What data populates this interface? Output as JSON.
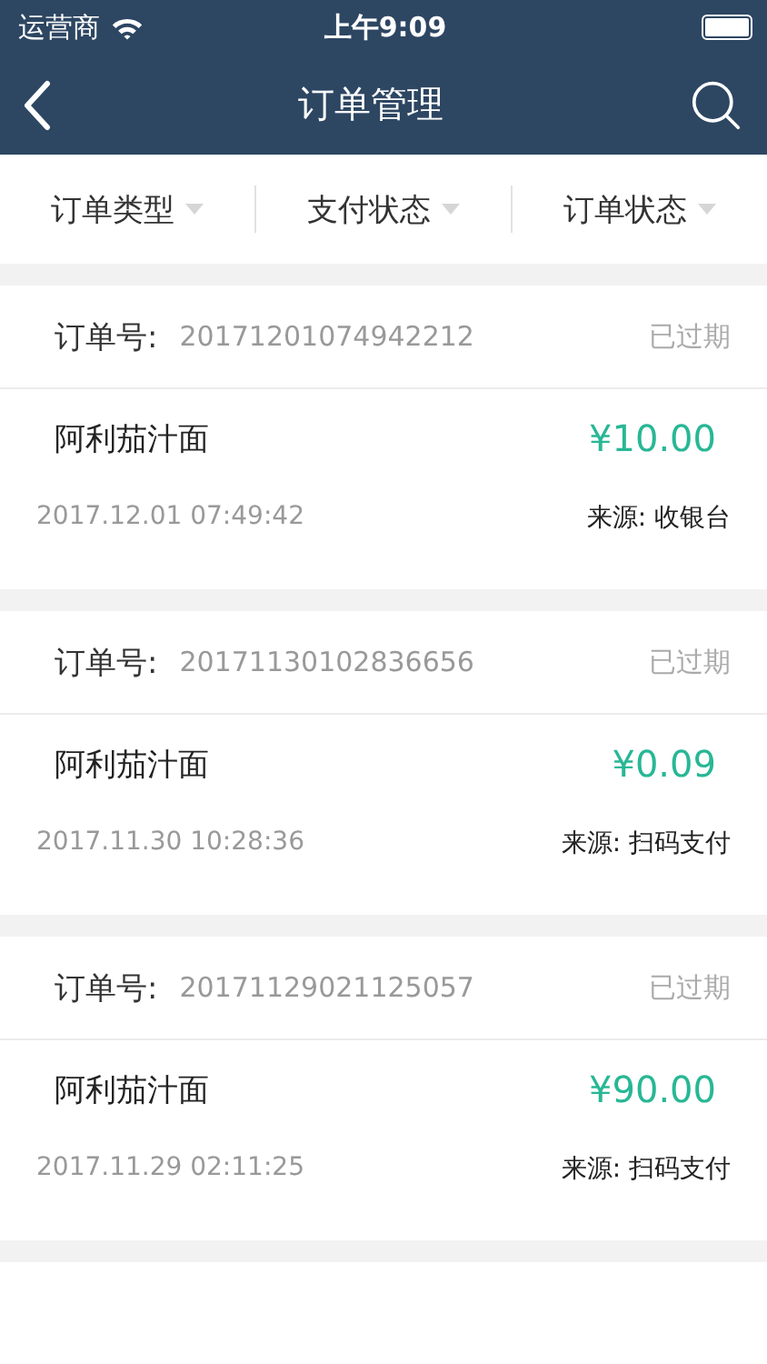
{
  "status_bar": {
    "carrier": "运营商",
    "time": "上午9:09"
  },
  "nav": {
    "title": "订单管理"
  },
  "filters": [
    {
      "label": "订单类型"
    },
    {
      "label": "支付状态"
    },
    {
      "label": "订单状态"
    }
  ],
  "orders": [
    {
      "number_label": "订单号:",
      "number": "20171201074942212",
      "status": "已过期",
      "name": "阿利茄汁面",
      "amount": "¥10.00",
      "time": "2017.12.01 07:49:42",
      "source": "来源: 收银台"
    },
    {
      "number_label": "订单号:",
      "number": "20171130102836656",
      "status": "已过期",
      "name": "阿利茄汁面",
      "amount": "¥0.09",
      "time": "2017.11.30 10:28:36",
      "source": "来源: 扫码支付"
    },
    {
      "number_label": "订单号:",
      "number": "20171129021125057",
      "status": "已过期",
      "name": "阿利茄汁面",
      "amount": "¥90.00",
      "time": "2017.11.29 02:11:25",
      "source": "来源: 扫码支付"
    }
  ]
}
